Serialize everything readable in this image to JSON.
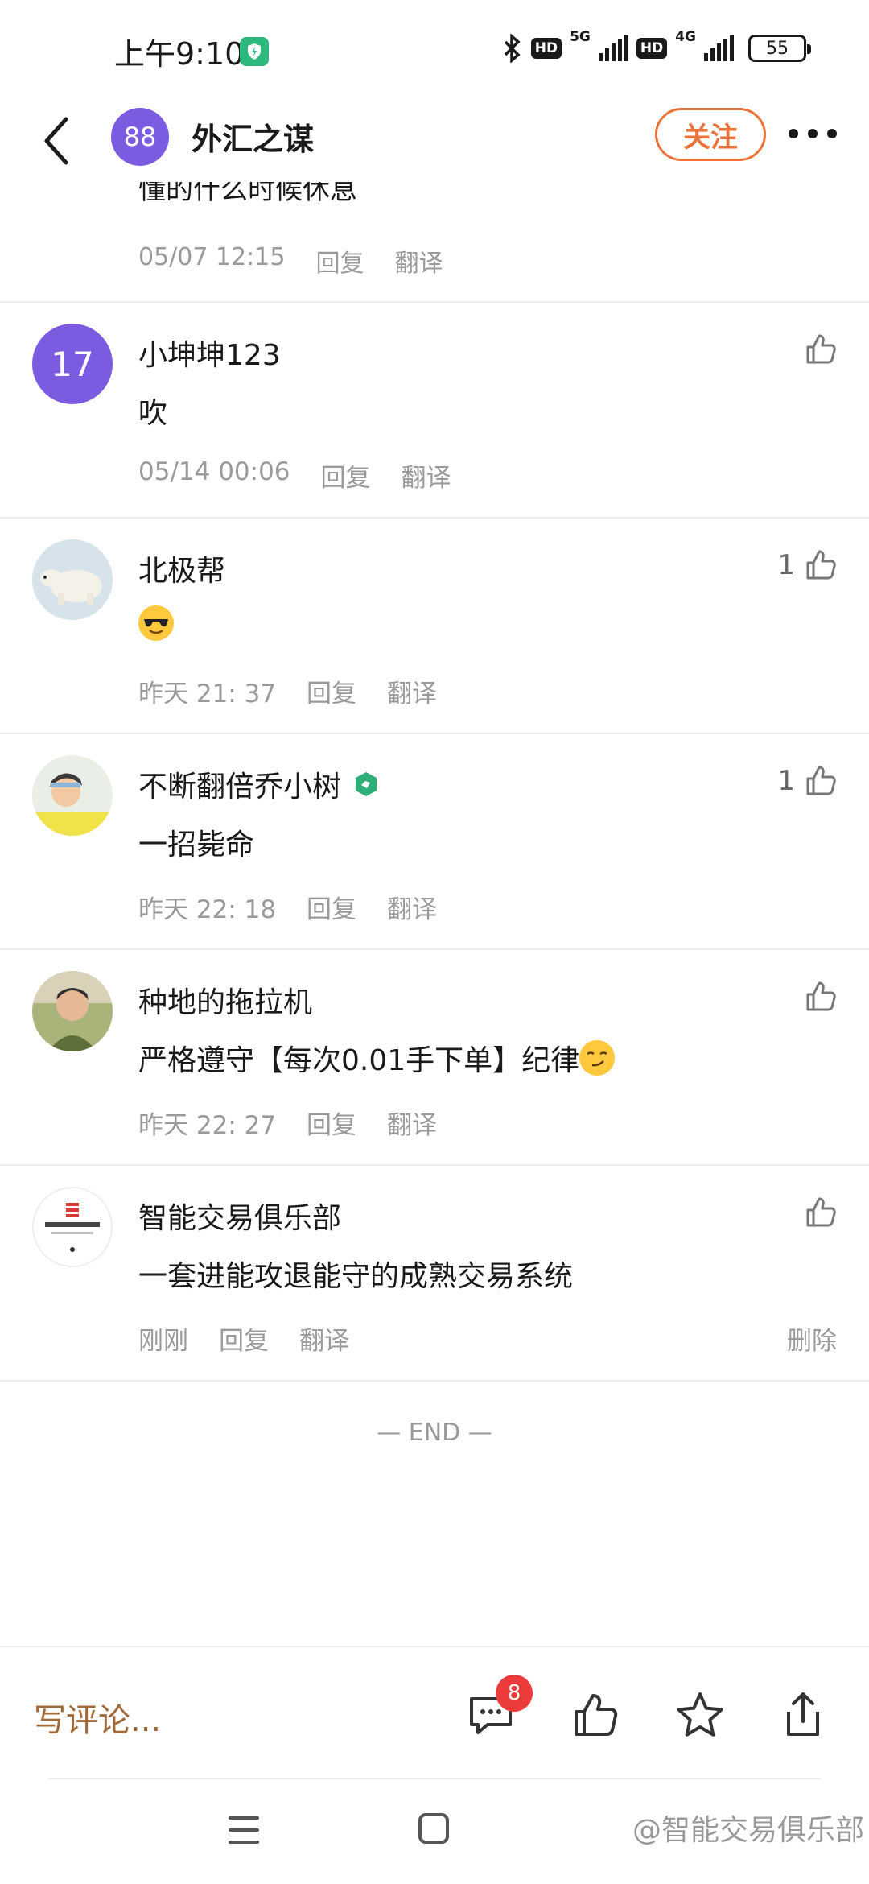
{
  "status_bar": {
    "time": "上午9:10",
    "hd1": "HD",
    "net1": "5G",
    "hd2": "HD",
    "net2": "4G",
    "battery": "55"
  },
  "header": {
    "avatar_text": "88",
    "title": "外汇之谋",
    "follow_label": "关注"
  },
  "partial_comment": {
    "text": "懂的什么时候休息",
    "time": "05/07 12:15",
    "reply": "回复",
    "translate": "翻译"
  },
  "comments": [
    {
      "avatar_text": "17",
      "name": "小坤坤123",
      "text": "吹",
      "time": "05/14 00:06",
      "reply": "回复",
      "translate": "翻译",
      "likes": ""
    },
    {
      "name": "北极帮",
      "text": "",
      "emoji": "sunglasses-emoji",
      "time": "昨天 21: 37",
      "reply": "回复",
      "translate": "翻译",
      "likes": "1"
    },
    {
      "name": "不断翻倍乔小树",
      "text": "一招毙命",
      "time": "昨天 22: 18",
      "reply": "回复",
      "translate": "翻译",
      "likes": "1"
    },
    {
      "name": "种地的拖拉机",
      "text": "严格遵守【每次0.01手下单】纪律",
      "emoji": "smirk-emoji",
      "time": "昨天 22: 27",
      "reply": "回复",
      "translate": "翻译",
      "likes": ""
    },
    {
      "name": "智能交易俱乐部",
      "text": "一套进能攻退能守的成熟交易系统",
      "time": "刚刚",
      "reply": "回复",
      "translate": "翻译",
      "likes": "",
      "delete": "删除"
    }
  ],
  "end_mark": "— END —",
  "bottom_bar": {
    "write_placeholder": "写评论...",
    "comment_count": "8"
  },
  "watermark": "@智能交易俱乐部",
  "colors": {
    "accent_orange": "#e8743b",
    "avatar_purple": "#7b5ce0",
    "badge_red": "#ec3b3b",
    "meta_gray": "#9a9a9a"
  }
}
